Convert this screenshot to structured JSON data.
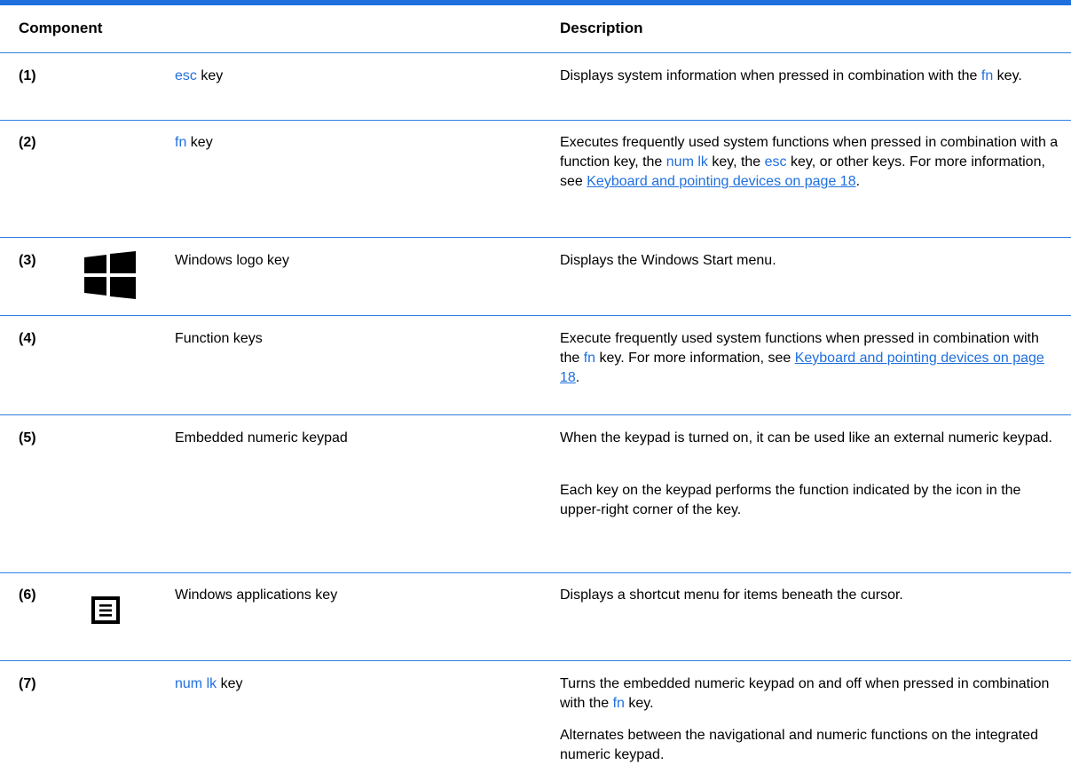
{
  "header": {
    "component": "Component",
    "description": "Description"
  },
  "rows": [
    {
      "num": "(1)",
      "comp_key": "esc",
      "comp_rest": " key",
      "desc": {
        "a": "Displays system information when pressed in combination with the ",
        "k1": "fn",
        "b": " key."
      }
    },
    {
      "num": "(2)",
      "comp_key": "fn",
      "comp_rest": " key",
      "desc": {
        "a": "Executes frequently used system functions when pressed in combination with a function key, the ",
        "k1": "num lk",
        "b": " key, the ",
        "k2": "esc",
        "c": " key, or other keys. For more information, see ",
        "link": "Keyboard and pointing devices on page 18",
        "d": "."
      }
    },
    {
      "num": "(3)",
      "icon": "windows-logo-icon",
      "comp": "Windows logo key",
      "desc": "Displays the Windows Start menu."
    },
    {
      "num": "(4)",
      "comp": "Function keys",
      "desc": {
        "a": "Execute frequently used system functions when pressed in combination with the ",
        "k1": "fn",
        "b": " key. For more information, see ",
        "link": "Keyboard and pointing devices on page 18",
        "d": "."
      }
    },
    {
      "num": "(5)",
      "comp": "Embedded numeric keypad",
      "desc_p1": "When the keypad is turned on, it can be used like an external numeric keypad.",
      "desc_p2": "Each key on the keypad performs the function indicated by the icon in the upper-right corner of the key."
    },
    {
      "num": "(6)",
      "icon": "windows-applications-key-icon",
      "comp": "Windows applications key",
      "desc": "Displays a shortcut menu for items beneath the cursor."
    },
    {
      "num": "(7)",
      "comp_key": "num lk",
      "comp_rest": " key",
      "desc": {
        "a": "Turns the embedded numeric keypad on and off when pressed in combination with the ",
        "k1": "fn",
        "b": " key."
      },
      "desc_p2": "Alternates between the navigational and numeric functions on the integrated numeric keypad."
    }
  ],
  "colors": {
    "accent": "#1f6fde",
    "rule": "#2f7fe0",
    "text": "#000000"
  }
}
